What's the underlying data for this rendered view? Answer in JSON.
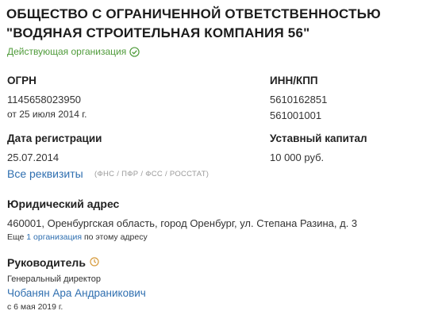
{
  "company": {
    "title": "ОБЩЕСТВО С ОГРАНИЧЕННОЙ ОТВЕТСТВЕННОСТЬЮ \"ВОДЯНАЯ СТРОИТЕЛЬНАЯ КОМПАНИЯ 56\"",
    "status": "Действующая организация",
    "status_color": "#4f9b3a"
  },
  "ogrn": {
    "label": "ОГРН",
    "value": "1145658023950",
    "date": "от 25 июля 2014 г."
  },
  "inn_kpp": {
    "label": "ИНН/КПП",
    "inn": "5610162851",
    "kpp": "561001001"
  },
  "registration": {
    "label": "Дата регистрации",
    "value": "25.07.2014"
  },
  "capital": {
    "label": "Уставный капитал",
    "value": "10 000 руб."
  },
  "requisites": {
    "link_label": "Все реквизиты",
    "sources": "(ФНС / ПФР / ФСС / РОССТАТ)"
  },
  "address": {
    "label": "Юридический адрес",
    "value": "460001, Оренбургская область, город Оренбург, ул. Степана Разина, д. 3",
    "more_prefix": "Еще",
    "more_link": "1 организация",
    "more_suffix": "по этому адресу"
  },
  "director": {
    "label": "Руководитель",
    "position": "Генеральный директор",
    "name": "Чобанян Ара Андраникович",
    "since": "с 6 мая 2019 г."
  },
  "colors": {
    "link": "#2f6fb0",
    "clock_icon": "#d69a3a"
  }
}
